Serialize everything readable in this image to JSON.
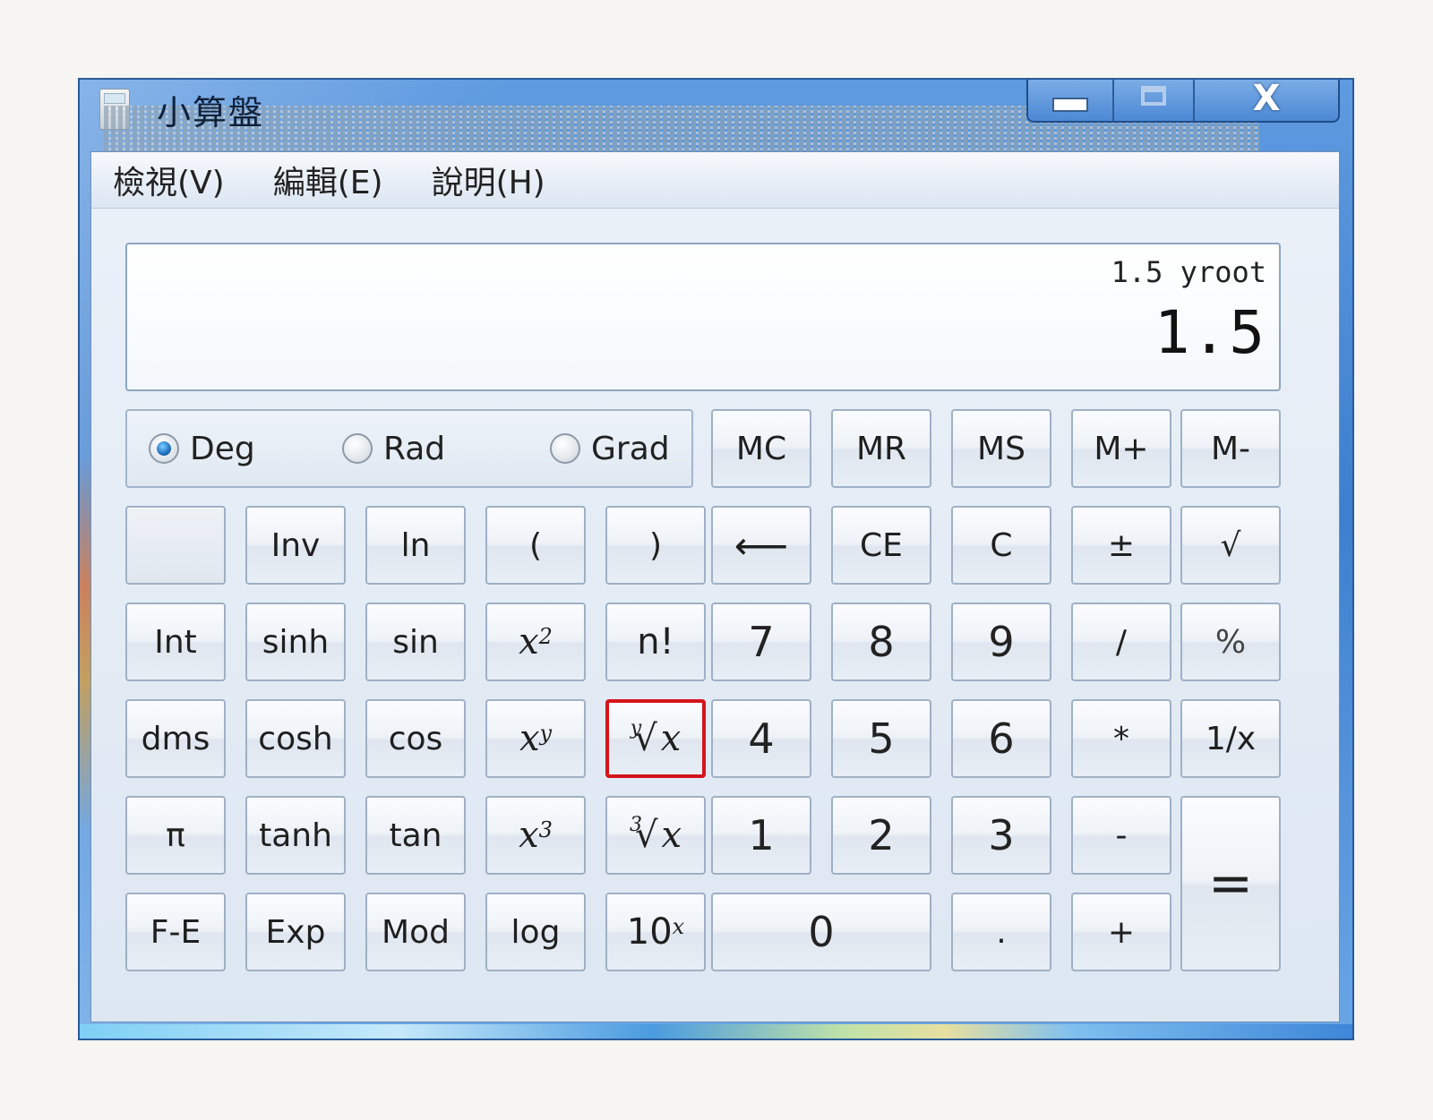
{
  "window": {
    "title": "小算盤",
    "controls": {
      "close": "X"
    }
  },
  "menu": [
    "檢視(V)",
    "編輯(E)",
    "說明(H)"
  ],
  "display": {
    "expression": "1.5 yroot",
    "value": "1.5"
  },
  "angle_modes": {
    "deg": "Deg",
    "rad": "Rad",
    "grad": "Grad",
    "selected": "Deg"
  },
  "memory_keys": [
    "MC",
    "MR",
    "MS",
    "M+",
    "M-"
  ],
  "keys": {
    "inv": "Inv",
    "ln": "ln",
    "lparen": "(",
    "rparen": ")",
    "backspace": "⟵",
    "ce": "CE",
    "c": "C",
    "negate": "±",
    "sqrt": "√",
    "int": "Int",
    "sinh": "sinh",
    "sin": "sin",
    "x": "x",
    "sq_exp": "2",
    "fact": "n!",
    "n7": "7",
    "n8": "8",
    "n9": "9",
    "div": "/",
    "pct": "%",
    "dms": "dms",
    "cosh": "cosh",
    "cos": "cos",
    "xy_exp": "y",
    "yroot": "∜x",
    "yroot_index": "y",
    "yroot_radical": "√",
    "n4": "4",
    "n5": "5",
    "n6": "6",
    "mul": "*",
    "recip": "1/x",
    "pi": "π",
    "tanh": "tanh",
    "tan": "tan",
    "cube_exp": "3",
    "cbrt_index": "3",
    "n1": "1",
    "n2": "2",
    "n3": "3",
    "sub": "-",
    "eq": "=",
    "fe": "F-E",
    "exp": "Exp",
    "mod": "Mod",
    "log": "log",
    "ten": "10",
    "ten_exp": "x",
    "n0": "0",
    "dot": ".",
    "add": "+"
  },
  "highlighted_key": "yroot"
}
